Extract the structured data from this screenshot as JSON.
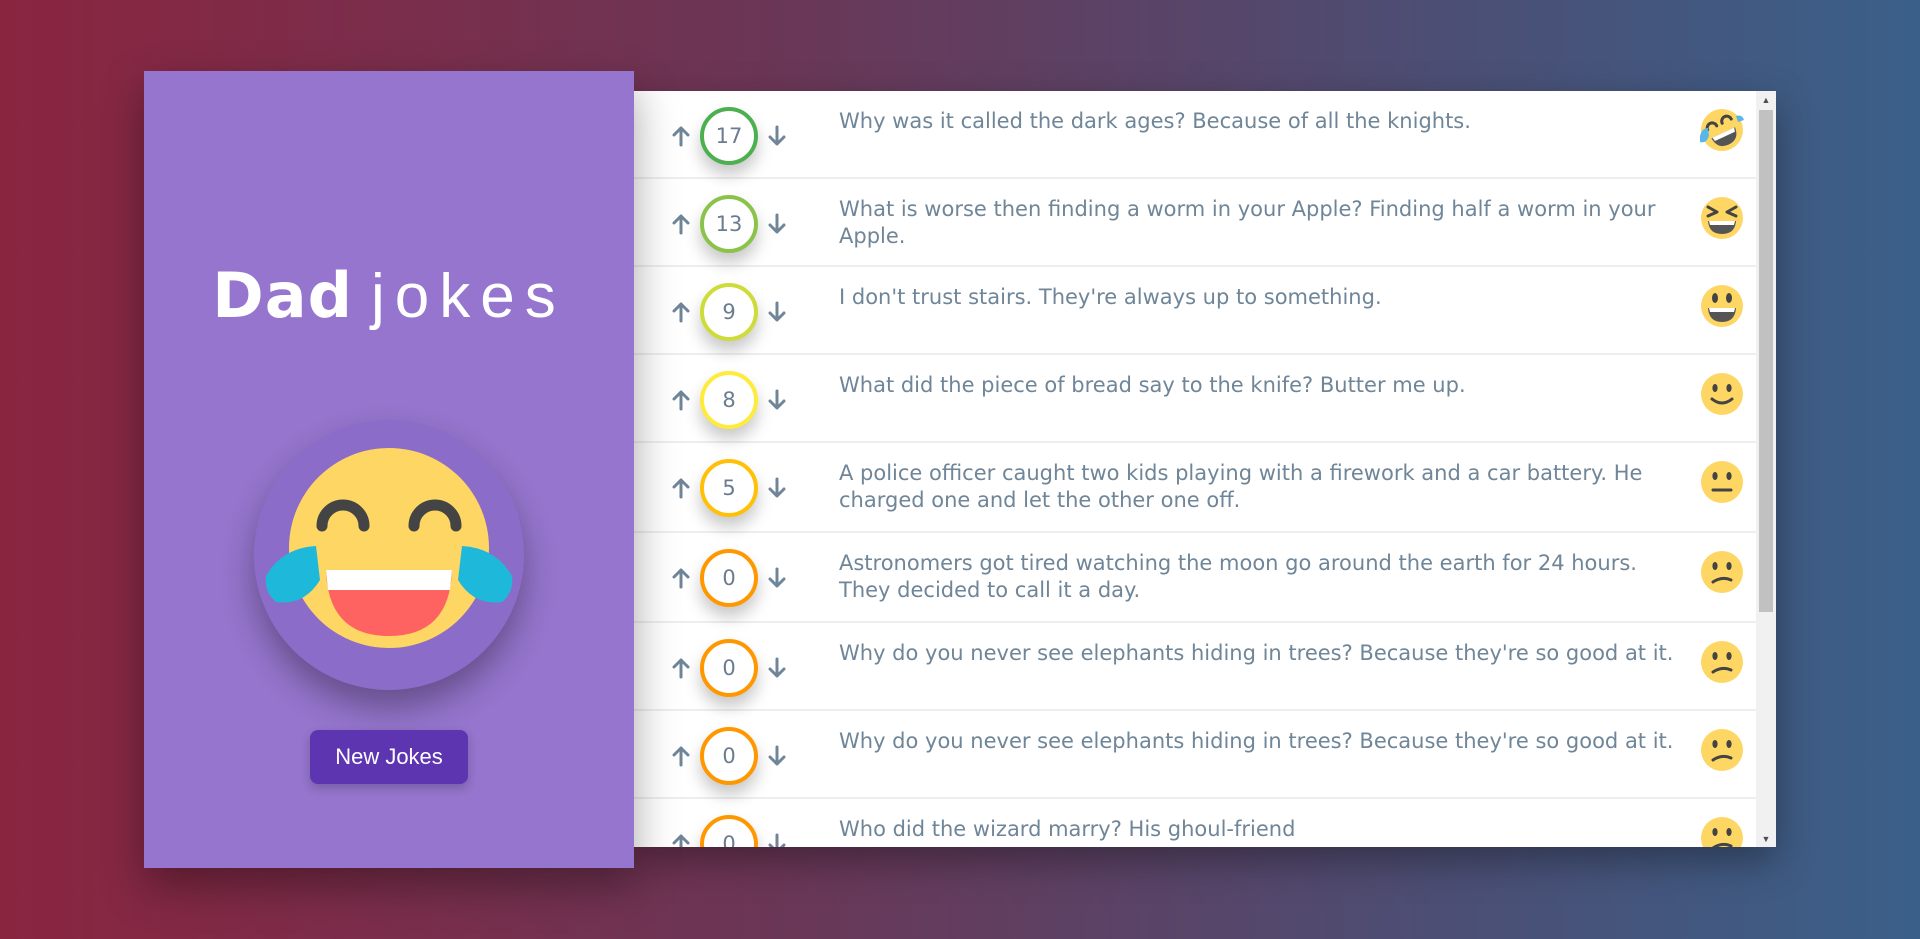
{
  "sidebar": {
    "title_bold": "Dad",
    "title_light": "jokes",
    "new_jokes_label": "New Jokes"
  },
  "jokes": [
    {
      "score": "17",
      "text": "Why was it called the dark ages? Because of all the knights.",
      "reaction": "rolling-on-floor-laughing",
      "color": "#4caf50"
    },
    {
      "score": "13",
      "text": "What is worse then finding a worm in your Apple? Finding half a worm in your Apple.",
      "reaction": "grinning-squinting",
      "color": "#8bc34a"
    },
    {
      "score": "9",
      "text": "I don't trust stairs. They're always up to something.",
      "reaction": "grinning-big-eyes",
      "color": "#cddc39"
    },
    {
      "score": "8",
      "text": "What did the piece of bread say to the knife? Butter me up.",
      "reaction": "slightly-smiling",
      "color": "#ffeb3b"
    },
    {
      "score": "5",
      "text": "A police officer caught two kids playing with a firework and a car battery. He charged one and let the other one off.",
      "reaction": "neutral",
      "color": "#ffc107"
    },
    {
      "score": "0",
      "text": "Astronomers got tired watching the moon go around the earth for 24 hours. They decided to call it a day.",
      "reaction": "confused",
      "color": "#ff9800"
    },
    {
      "score": "0",
      "text": "Why do you never see elephants hiding in trees? Because they're so good at it.",
      "reaction": "confused",
      "color": "#ff9800"
    },
    {
      "score": "0",
      "text": "Why do you never see elephants hiding in trees? Because they're so good at it.",
      "reaction": "confused",
      "color": "#ff9800"
    },
    {
      "score": "0",
      "text": "Who did the wizard marry? His ghoul-friend",
      "reaction": "confused",
      "color": "#ff9800"
    }
  ],
  "colors": {
    "sidebar_bg": "#9575cd",
    "button_bg": "#5e35b1",
    "text": "#6f8598"
  }
}
